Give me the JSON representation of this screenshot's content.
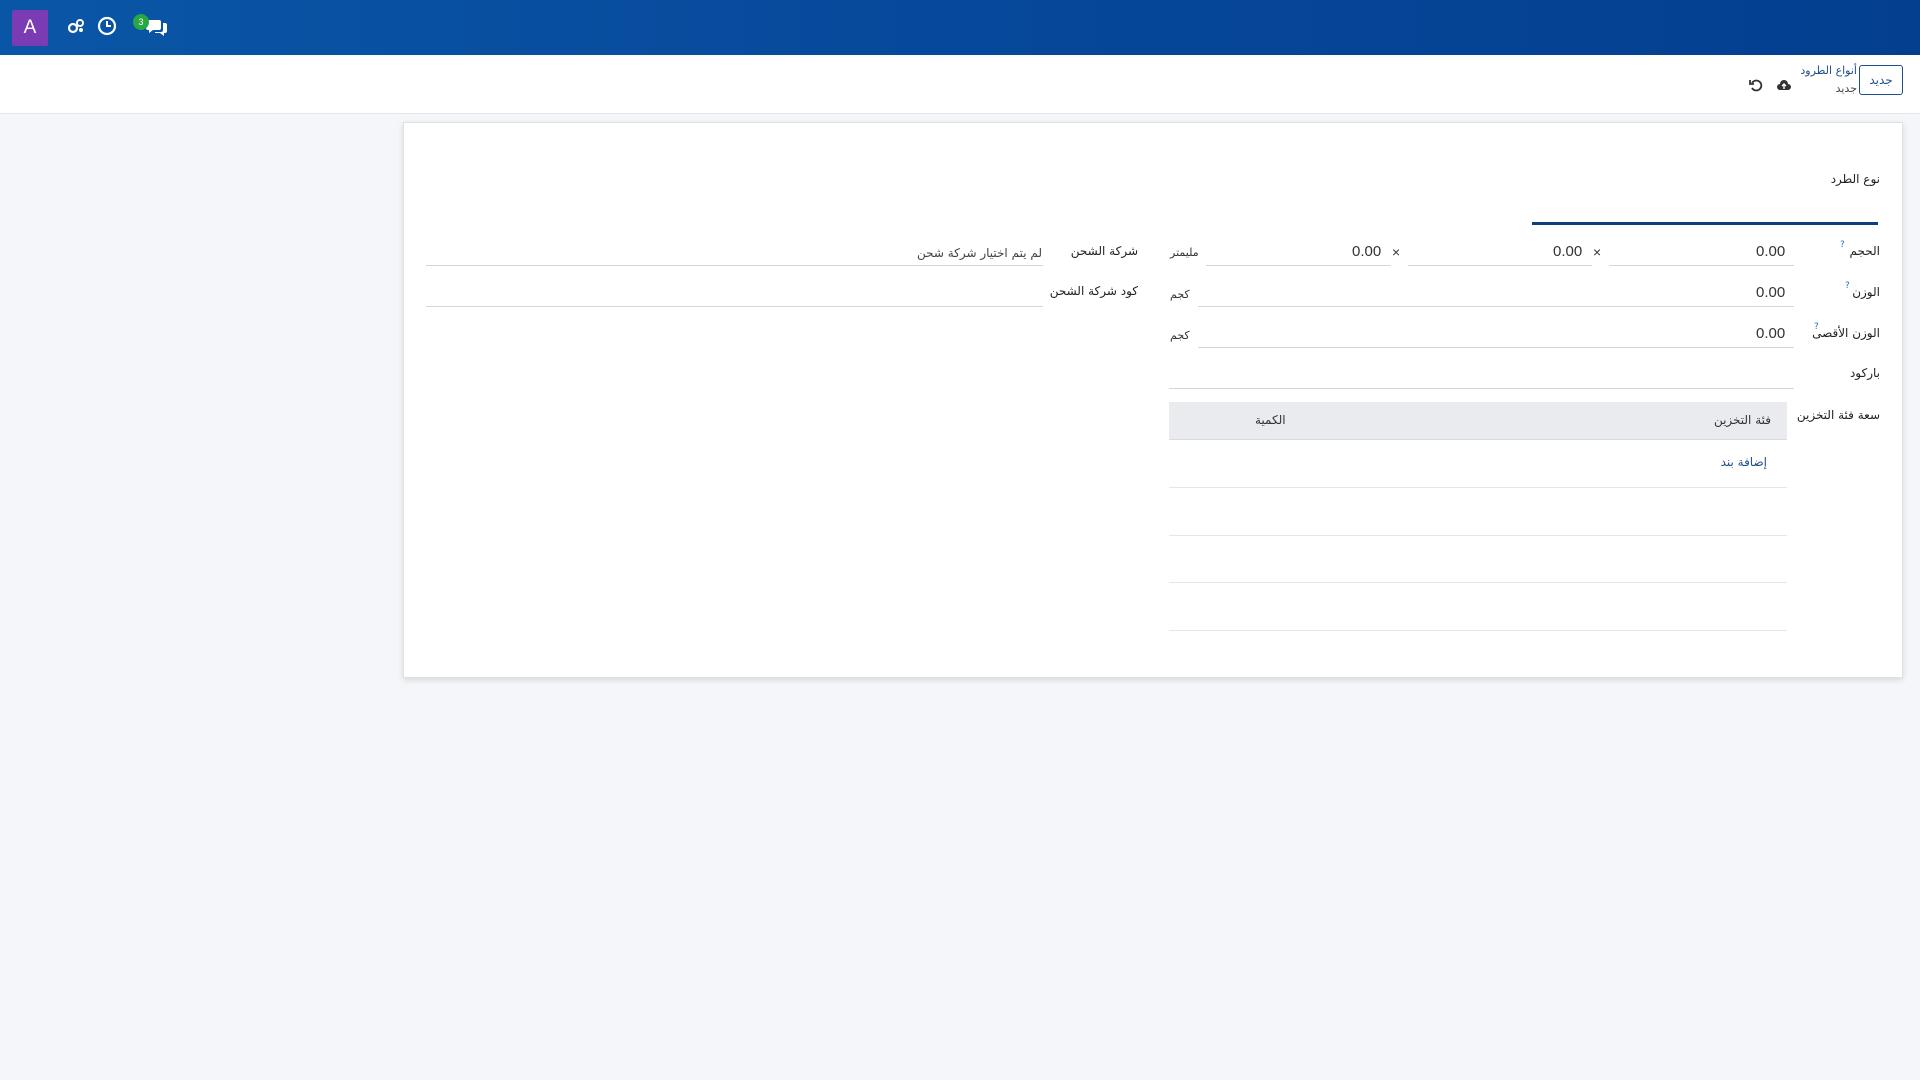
{
  "navbar": {
    "avatar_letter": "A",
    "chat_badge_count": "3",
    "icons": [
      "activity-icon",
      "clock-icon",
      "chat-icon"
    ]
  },
  "control_panel": {
    "new_button": "جديد",
    "breadcrumb_parent": "أنواع الطرود",
    "breadcrumb_current": "جديد",
    "icons": [
      "cloud-save-icon",
      "discard-icon"
    ]
  },
  "form": {
    "package_type_label": "نوع الطرد",
    "size_label": "الحجم",
    "size_help": "?",
    "size_values": [
      "0.00",
      "0.00",
      "0.00"
    ],
    "size_separator": "×",
    "size_unit": "مليمتر",
    "weight_label": "الوزن",
    "weight_help": "?",
    "weight_value": "0.00",
    "weight_unit": "كجم",
    "max_weight_label": "الوزن الأقصى",
    "max_weight_help": "?",
    "max_weight_value": "0.00",
    "max_weight_unit": "كجم",
    "barcode_label": "باركود",
    "storage_capacity_label": "سعة فئة التخزين",
    "carrier_label": "شركة الشحن",
    "carrier_placeholder": "لم يتم اختيار شركة شحن",
    "carrier_code_label": "كود شركة الشحن",
    "storage_table": {
      "columns": [
        "فئة التخزين",
        "الكمية"
      ],
      "add_line": "إضافة بند"
    }
  },
  "colors": {
    "navbar": "#06479a",
    "avatar": "#7b3bb5",
    "badge": "#28a745",
    "accent": "#1f4f8b"
  }
}
